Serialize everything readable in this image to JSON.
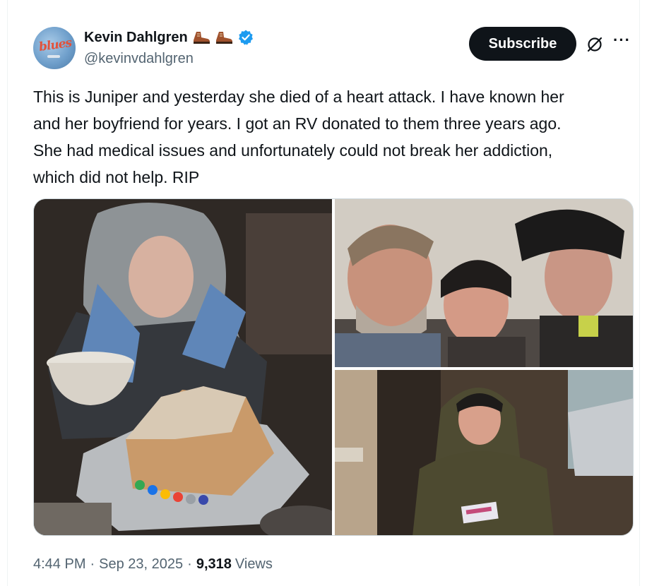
{
  "author": {
    "display_name": "Kevin Dahlgren",
    "handle": "@kevinvdahlgren",
    "avatar_text": "blues",
    "verified": true,
    "name_emoji_icons": [
      "hiking-boot-icon",
      "hiking-boot-icon"
    ]
  },
  "actions": {
    "subscribe_label": "Subscribe",
    "grok_icon": "grok-icon",
    "more_icon": "more-icon",
    "more_label": "···"
  },
  "tweet": {
    "text": "This is Juniper and yesterday she died of a heart attack. I have known her\nand her boyfriend for years. I got an RV donated to them three years ago.\nShe had medical issues and unfortunately could not break her addiction,\nwhich did not help. RIP"
  },
  "media": [
    {
      "id": "photo-1",
      "kind": "photo"
    },
    {
      "id": "photo-2",
      "kind": "photo"
    },
    {
      "id": "photo-3",
      "kind": "photo"
    }
  ],
  "meta": {
    "time": "4:44 PM",
    "separator": "·",
    "date": "Sep 23, 2025",
    "views_count": "9,318",
    "views_label": "Views"
  },
  "colors": {
    "text_primary": "#0f1419",
    "text_secondary": "#536471",
    "verified_blue": "#1d9bf0",
    "button_dark": "#0f1419",
    "border": "#cfd9de"
  }
}
